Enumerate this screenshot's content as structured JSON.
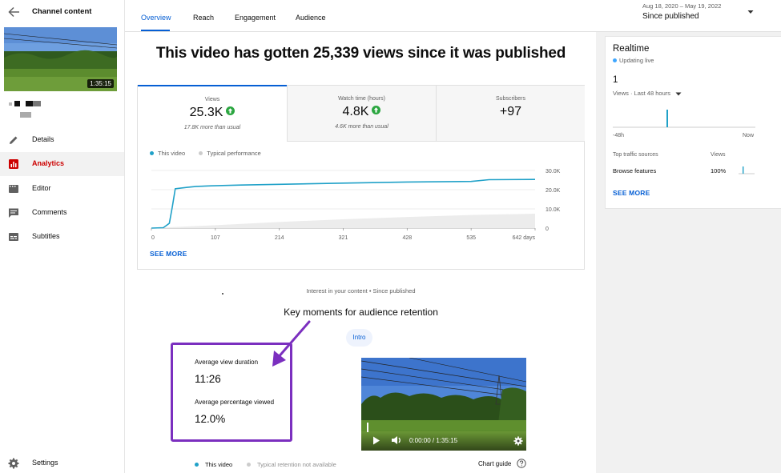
{
  "sidebar": {
    "title": "Channel content",
    "thumb_duration": "1:35:15",
    "items": [
      {
        "label": "Details"
      },
      {
        "label": "Analytics"
      },
      {
        "label": "Editor"
      },
      {
        "label": "Comments"
      },
      {
        "label": "Subtitles"
      }
    ],
    "settings_label": "Settings"
  },
  "tabs": [
    "Overview",
    "Reach",
    "Engagement",
    "Audience"
  ],
  "date": {
    "range": "Aug 18, 2020 – May 19, 2022",
    "value": "Since published"
  },
  "headline": "This video has gotten 25,339 views since it was published",
  "metrics": [
    {
      "title": "Views",
      "value": "25.3K",
      "sub": "17.8K more than usual"
    },
    {
      "title": "Watch time (hours)",
      "value": "4.8K",
      "sub": "4.6K more than usual"
    },
    {
      "title": "Subscribers",
      "value": "+97",
      "sub": ""
    }
  ],
  "legend": {
    "this_video": "This video",
    "typical": "Typical performance"
  },
  "chart_data": {
    "type": "line",
    "x_ticks": [
      "0",
      "107",
      "214",
      "321",
      "428",
      "535",
      "642 days"
    ],
    "y_ticks": [
      "0",
      "10.0K",
      "20.0K",
      "30.0K"
    ],
    "ylim": [
      0,
      30000
    ],
    "series": [
      {
        "name": "This video",
        "x": [
          0,
          20,
          30,
          35,
          40,
          60,
          75,
          100,
          150,
          214,
          321,
          428,
          535,
          565,
          642
        ],
        "y": [
          0,
          200,
          2500,
          11000,
          20500,
          21200,
          21700,
          22000,
          22400,
          22800,
          23400,
          24000,
          24300,
          25200,
          25339
        ]
      },
      {
        "name": "Typical performance",
        "x": [
          0,
          107,
          214,
          321,
          428,
          535,
          642
        ],
        "y": [
          0,
          1500,
          3200,
          4600,
          5800,
          6800,
          7500
        ]
      }
    ],
    "colors": {
      "this_video": "#20a1c8",
      "typical": "#cccccc"
    }
  },
  "see_more": "SEE MORE",
  "interest": "Interest in your content • Since published",
  "key_moments_title": "Key moments for audience retention",
  "intro_chip": "Intro",
  "retention": {
    "avg_duration_label": "Average view duration",
    "avg_duration_value": "11:26",
    "avg_pct_label": "Average percentage viewed",
    "avg_pct_value": "12.0%"
  },
  "video_player": {
    "time": "0:00:00 / 1:35:15"
  },
  "bottom_legend": {
    "this_video": "This video",
    "typical": "Typical retention not available"
  },
  "chart_guide": "Chart guide",
  "realtime": {
    "title": "Realtime",
    "live": "Updating live",
    "count": "1",
    "select": "Views · Last 48 hours",
    "axis_left": "-48h",
    "axis_right": "Now",
    "src_header": "Top traffic sources",
    "src_col": "Views",
    "src_name": "Browse features",
    "src_value": "100%",
    "see_more": "SEE MORE"
  }
}
